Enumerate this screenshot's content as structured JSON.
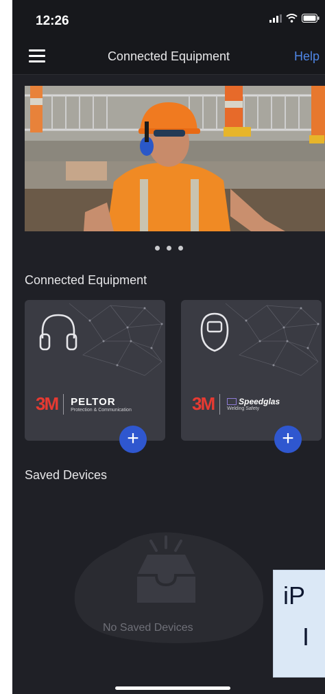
{
  "status_bar": {
    "time": "12:26"
  },
  "navbar": {
    "title": "Connected Equipment",
    "help_label": "Help"
  },
  "carousel": {
    "page_count": 3,
    "active_index": 0
  },
  "connected_equipment": {
    "title": "Connected Equipment",
    "cards": [
      {
        "icon": "headphones-icon",
        "brand_mark": "3M",
        "product_name": "PELTOR",
        "product_sub": "Protection & Communication",
        "add_label": "+"
      },
      {
        "icon": "welding-mask-icon",
        "brand_mark": "3M",
        "product_name": "Speedglas",
        "product_sub": "Welding Safety",
        "add_label": "+"
      }
    ]
  },
  "saved_devices": {
    "title": "Saved Devices",
    "empty_message": "No Saved Devices"
  },
  "overlay": {
    "line1": "iP",
    "line2": "I"
  },
  "colors": {
    "accent": "#2f57cf",
    "help": "#4f86e6",
    "background": "#1f2026",
    "brand_red": "#e63a32"
  }
}
